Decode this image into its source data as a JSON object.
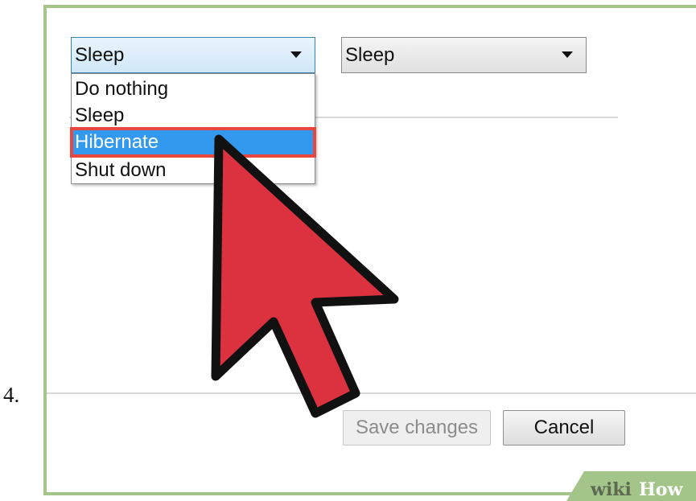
{
  "step": {
    "number": "4."
  },
  "power_settings": {
    "dropdown_left": {
      "selected": "Sleep",
      "expanded": true,
      "options": [
        "Do nothing",
        "Sleep",
        "Hibernate",
        "Shut down"
      ],
      "highlighted_option": "Hibernate"
    },
    "dropdown_right": {
      "selected": "Sleep",
      "expanded": false
    }
  },
  "buttons": {
    "save_label": "Save changes",
    "save_enabled": false,
    "cancel_label": "Cancel"
  },
  "watermark": {
    "part1": "wiki",
    "part2": "How"
  },
  "colors": {
    "highlight": "#3399ee",
    "annotation_box": "#e8473e",
    "cursor_fill": "#dc3240",
    "frame_border": "#a3c58a"
  },
  "icons": {
    "dropdown_arrow": "chevron-down-icon",
    "pointer": "arrow-cursor-icon"
  }
}
